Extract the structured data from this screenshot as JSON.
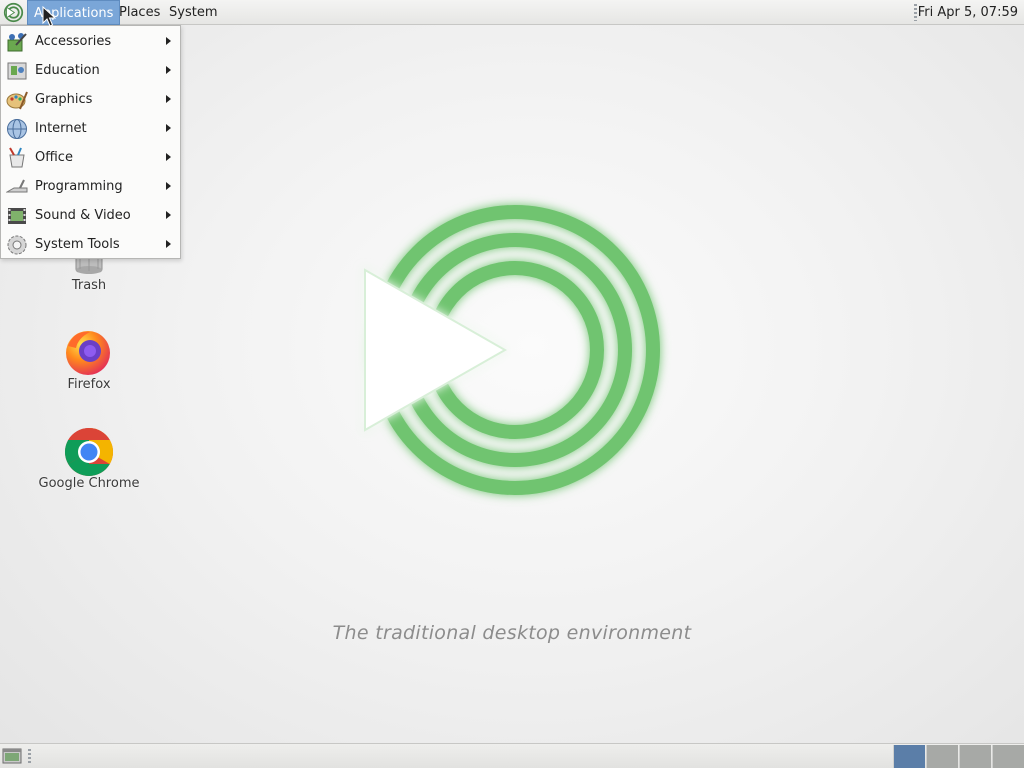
{
  "top_panel": {
    "menus": [
      "Applications",
      "Places",
      "System"
    ],
    "clock": "Fri Apr  5, 07:59"
  },
  "app_menu": {
    "items": [
      {
        "label": "Accessories",
        "icon": "accessories-icon"
      },
      {
        "label": "Education",
        "icon": "education-icon"
      },
      {
        "label": "Graphics",
        "icon": "graphics-icon"
      },
      {
        "label": "Internet",
        "icon": "internet-icon"
      },
      {
        "label": "Office",
        "icon": "office-icon"
      },
      {
        "label": "Programming",
        "icon": "programming-icon"
      },
      {
        "label": "Sound & Video",
        "icon": "sound-video-icon"
      },
      {
        "label": "System Tools",
        "icon": "system-tools-icon"
      }
    ]
  },
  "desktop": {
    "icons": [
      {
        "label": "Trash",
        "icon": "trash-icon"
      },
      {
        "label": "Firefox",
        "icon": "firefox-icon"
      },
      {
        "label": "Google Chrome",
        "icon": "chrome-icon"
      }
    ],
    "tagline": "The traditional desktop environment"
  },
  "bottom_panel": {
    "workspaces_count": 4,
    "active_workspace": 1
  },
  "colors": {
    "accent_green": "#6fc46f",
    "menu_highlight": "#7aa6d8",
    "active_workspace": "#5b7ea8"
  }
}
